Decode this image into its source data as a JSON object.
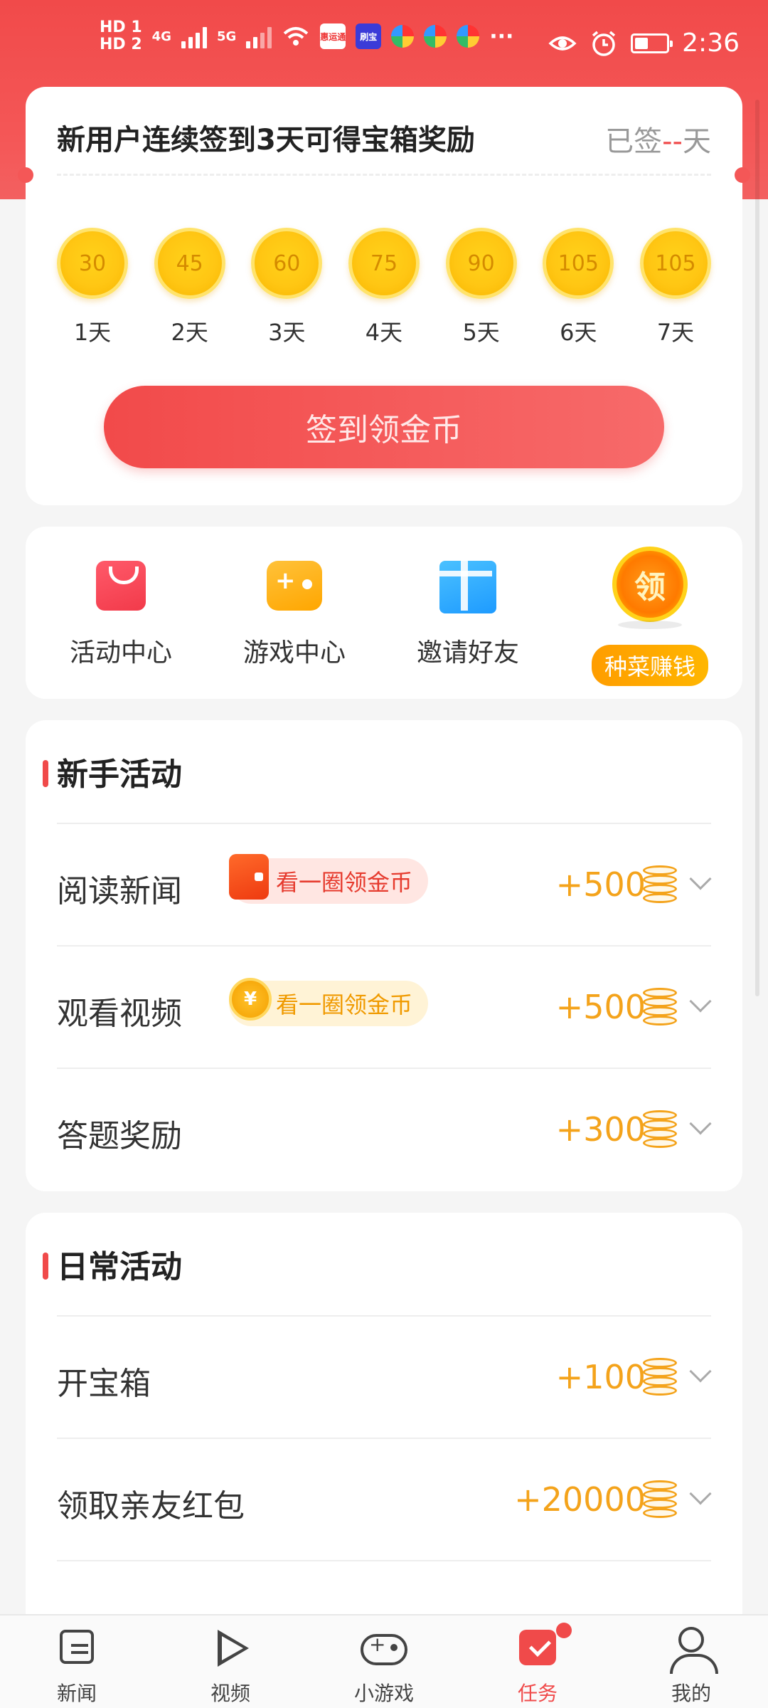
{
  "status_bar": {
    "tags": [
      "HD 1",
      "HD 2"
    ],
    "network": [
      "4G",
      "5G"
    ],
    "apps": [
      "惠运通",
      "刷宝"
    ],
    "more": "···",
    "time": "2:36"
  },
  "signin": {
    "title": "新用户连续签到3天可得宝箱奖励",
    "status_prefix": "已签",
    "status_count": "--",
    "status_suffix": "天",
    "days": [
      {
        "coins": "30",
        "day": "1天"
      },
      {
        "coins": "45",
        "day": "2天"
      },
      {
        "coins": "60",
        "day": "3天"
      },
      {
        "coins": "75",
        "day": "4天"
      },
      {
        "coins": "90",
        "day": "5天"
      },
      {
        "coins": "105",
        "day": "6天"
      },
      {
        "coins": "105",
        "day": "7天"
      }
    ],
    "button": "签到领金币"
  },
  "shortcuts": {
    "activity": "活动中心",
    "games": "游戏中心",
    "invite": "邀请好友",
    "claim_icon": "领",
    "claim_badge": "种菜赚钱"
  },
  "novice": {
    "title": "新手活动",
    "rows": [
      {
        "label": "阅读新闻",
        "tag": "看一圈领金币",
        "reward": "+500"
      },
      {
        "label": "观看视频",
        "tag": "看一圈领金币",
        "tag_coin": "¥",
        "reward": "+500"
      },
      {
        "label": "答题奖励",
        "reward": "+300"
      }
    ]
  },
  "daily": {
    "title": "日常活动",
    "rows": [
      {
        "label": "开宝箱",
        "reward": "+100"
      },
      {
        "label": "领取亲友红包",
        "reward": "+20000"
      }
    ]
  },
  "nav": {
    "news": "新闻",
    "video": "视频",
    "games": "小游戏",
    "tasks": "任务",
    "me": "我的"
  },
  "colors": {
    "brand_red": "#f04a4a",
    "reward_orange": "#f4a31b",
    "coin_gold": "#ffc613"
  }
}
